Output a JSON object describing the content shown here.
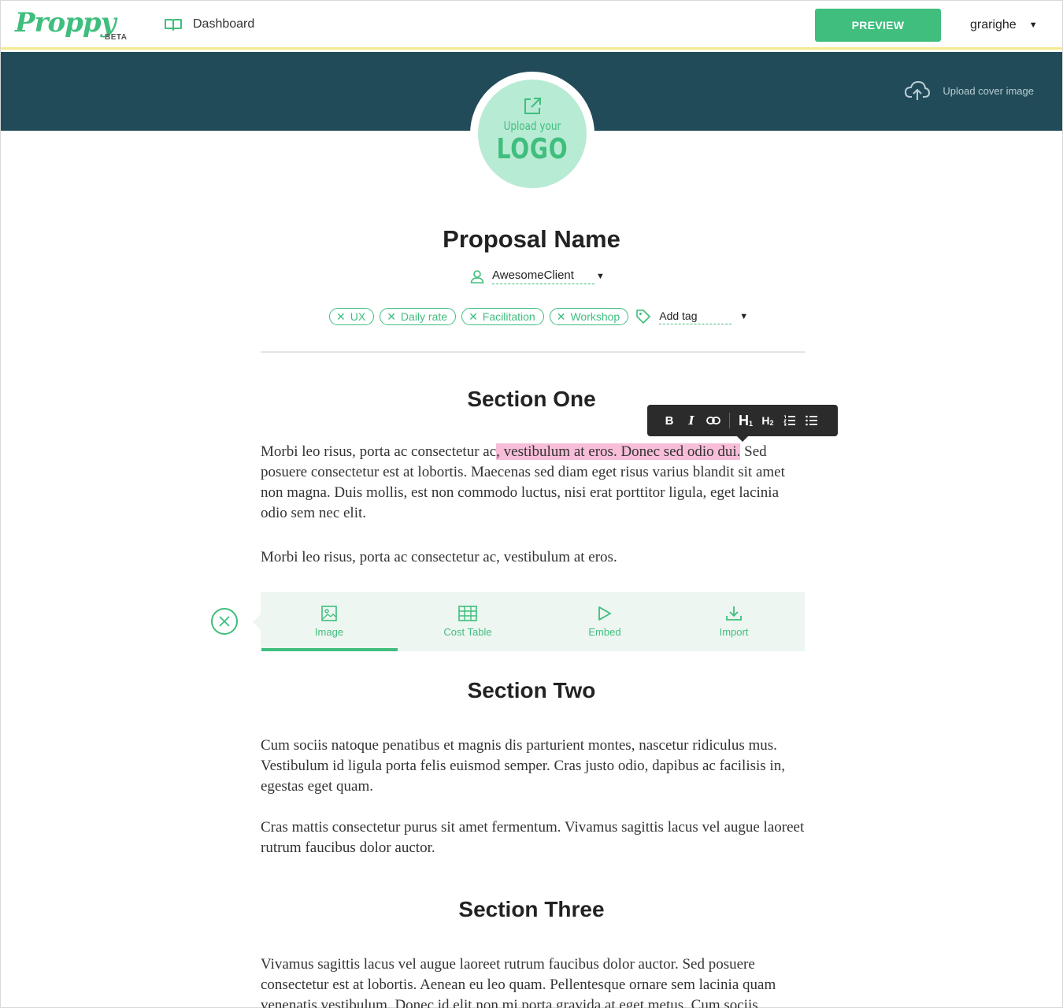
{
  "header": {
    "brand": "Proppy",
    "brand_badge": "BETA",
    "nav_dashboard": "Dashboard",
    "preview_label": "PREVIEW",
    "username": "grarighe"
  },
  "cover": {
    "upload_cover_label": "Upload cover image",
    "logo_small_text": "Upload your",
    "logo_big_text": "LOGO"
  },
  "proposal": {
    "title": "Proposal Name",
    "client": "AwesomeClient",
    "tags": [
      "UX",
      "Daily rate",
      "Facilitation",
      "Workshop"
    ],
    "add_tag_placeholder": "Add tag"
  },
  "toolbar": {
    "buttons": [
      "bold",
      "italic",
      "link",
      "heading-1",
      "heading-2",
      "ordered-list",
      "bulleted-list"
    ]
  },
  "sections": [
    {
      "heading": "Section One",
      "p1_before": "Morbi leo risus, porta ac consectetur ac",
      "p1_highlight": ", vestibulum at eros. Donec sed odio dui.",
      "p1_after": " Sed posuere consectetur est at lobortis. Maecenas sed diam eget risus varius blandit sit amet non magna. Duis mollis, est non commodo luctus, nisi erat porttitor ligula, eget lacinia odio sem nec elit.",
      "p2": "Morbi leo risus, porta ac consectetur ac, vestibulum at eros."
    },
    {
      "heading": "Section Two",
      "p1": "Cum sociis natoque penatibus et magnis dis parturient montes, nascetur ridiculus mus. Vestibulum id ligula porta felis euismod semper. Cras justo odio, dapibus ac facilisis in, egestas eget quam.",
      "p2": "Cras mattis consectetur purus sit amet fermentum. Vivamus sagittis lacus vel augue laoreet rutrum faucibus dolor auctor."
    },
    {
      "heading": "Section Three",
      "p1": "Vivamus sagittis lacus vel augue laoreet rutrum faucibus dolor auctor. Sed posuere consectetur est at lobortis. Aenean eu leo quam. Pellentesque ornare sem lacinia quam venenatis vestibulum. Donec id elit non mi porta gravida at eget metus. Cum sociis"
    }
  ],
  "insert_menu": {
    "items": [
      {
        "label": "Image",
        "icon": "image-icon",
        "active": true
      },
      {
        "label": "Cost Table",
        "icon": "table-icon",
        "active": false
      },
      {
        "label": "Embed",
        "icon": "play-icon",
        "active": false
      },
      {
        "label": "Import",
        "icon": "download-icon",
        "active": false
      }
    ]
  },
  "colors": {
    "brand_green": "#3fbe7e",
    "cover_bg": "#224b5a",
    "highlight_pink": "#f7bdd9",
    "logo_circle": "#b8ebd3",
    "insert_bar_bg": "#edf6f0"
  }
}
